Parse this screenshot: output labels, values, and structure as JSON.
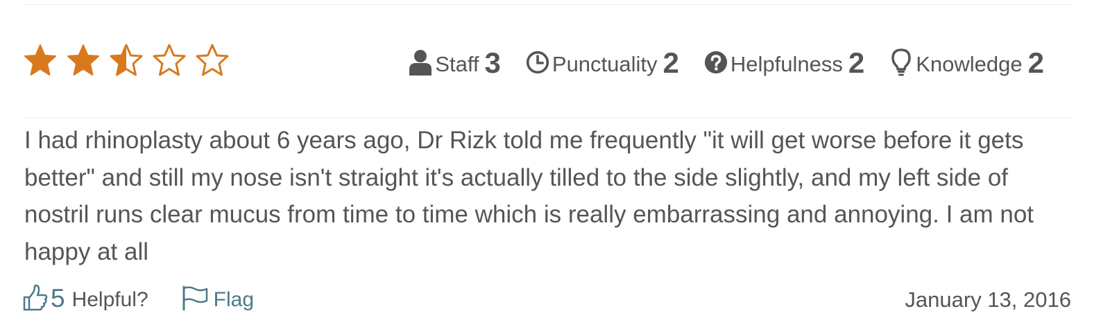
{
  "rating": {
    "stars_value": 2.5,
    "stars_max": 5,
    "star_color": "#D77A1E"
  },
  "metrics": [
    {
      "icon": "user-icon",
      "label": "Staff",
      "value": "3"
    },
    {
      "icon": "clock-icon",
      "label": "Punctuality",
      "value": "2"
    },
    {
      "icon": "question-circle-icon",
      "label": "Helpfulness",
      "value": "2"
    },
    {
      "icon": "lightbulb-icon",
      "label": "Knowledge",
      "value": "2"
    }
  ],
  "review": {
    "text": "I had rhinoplasty about 6 years ago, Dr Rizk told me frequently \"it will get worse before it gets better\" and still my nose isn't straight it's actually tilled to the side slightly, and my left side of nostril runs clear mucus from time to time which is really embarrassing and annoying. I am not happy at all",
    "date": "January 13, 2016"
  },
  "footer": {
    "helpful_count": "5",
    "helpful_label": "Helpful?",
    "flag_label": "Flag",
    "link_color": "#4A7A8A"
  }
}
